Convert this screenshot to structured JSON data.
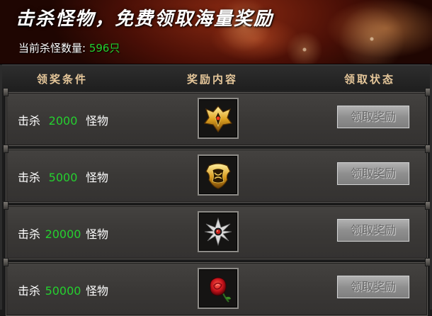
{
  "banner": {
    "title": "击杀怪物，免费领取海量奖励",
    "kill_count_label": "当前杀怪数量:",
    "kill_count_value": "596只"
  },
  "table": {
    "headers": [
      "领奖条件",
      "奖励内容",
      "领取状态"
    ],
    "rows": [
      {
        "prefix": "击杀",
        "count": "2000",
        "suffix": "怪物",
        "reward_icon": "golden-wing-helmet-icon",
        "button_label": "领取奖励"
      },
      {
        "prefix": "击杀",
        "count": "5000",
        "suffix": "怪物",
        "reward_icon": "golden-ornate-armor-icon",
        "button_label": "领取奖励"
      },
      {
        "prefix": "击杀",
        "count": "20000",
        "suffix": "怪物",
        "reward_icon": "silver-star-gem-icon",
        "button_label": "领取奖励"
      },
      {
        "prefix": "击杀",
        "count": "50000",
        "suffix": "怪物",
        "reward_icon": "red-rose-icon",
        "button_label": "领取奖励"
      }
    ]
  },
  "colors": {
    "highlight_green": "#25d02f",
    "header_gold": "#e6c79a",
    "button_disabled_text": "#6a6a6a"
  }
}
